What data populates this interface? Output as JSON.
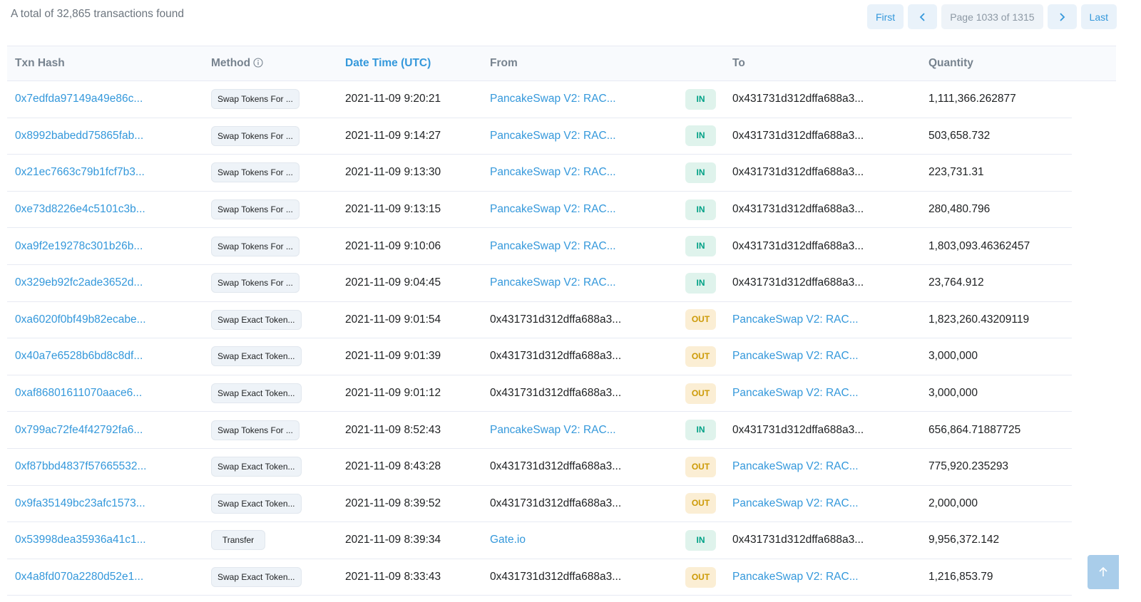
{
  "summary": "A total of 32,865 transactions found",
  "pager": {
    "first": "First",
    "page_info": "Page 1033 of 1315",
    "last": "Last"
  },
  "headers": {
    "txn_hash": "Txn Hash",
    "method": "Method",
    "datetime": "Date Time (UTC)",
    "from": "From",
    "to": "To",
    "quantity": "Quantity"
  },
  "rows": [
    {
      "hash": "0x7edfda97149a49e86c...",
      "method": "Swap Tokens For ...",
      "datetime": "2021-11-09 9:20:21",
      "from": "PancakeSwap V2: RAC...",
      "dir": "IN",
      "to": "0x431731d312dffa688a3...",
      "quantity": "1,111,366.262877"
    },
    {
      "hash": "0x8992babedd75865fab...",
      "method": "Swap Tokens For ...",
      "datetime": "2021-11-09 9:14:27",
      "from": "PancakeSwap V2: RAC...",
      "dir": "IN",
      "to": "0x431731d312dffa688a3...",
      "quantity": "503,658.732"
    },
    {
      "hash": "0x21ec7663c79b1fcf7b3...",
      "method": "Swap Tokens For ...",
      "datetime": "2021-11-09 9:13:30",
      "from": "PancakeSwap V2: RAC...",
      "dir": "IN",
      "to": "0x431731d312dffa688a3...",
      "quantity": "223,731.31"
    },
    {
      "hash": "0xe73d8226e4c5101c3b...",
      "method": "Swap Tokens For ...",
      "datetime": "2021-11-09 9:13:15",
      "from": "PancakeSwap V2: RAC...",
      "dir": "IN",
      "to": "0x431731d312dffa688a3...",
      "quantity": "280,480.796"
    },
    {
      "hash": "0xa9f2e19278c301b26b...",
      "method": "Swap Tokens For ...",
      "datetime": "2021-11-09 9:10:06",
      "from": "PancakeSwap V2: RAC...",
      "dir": "IN",
      "to": "0x431731d312dffa688a3...",
      "quantity": "1,803,093.46362457"
    },
    {
      "hash": "0x329eb92fc2ade3652d...",
      "method": "Swap Tokens For ...",
      "datetime": "2021-11-09 9:04:45",
      "from": "PancakeSwap V2: RAC...",
      "dir": "IN",
      "to": "0x431731d312dffa688a3...",
      "quantity": "23,764.912"
    },
    {
      "hash": "0xa6020f0bf49b82ecabe...",
      "method": "Swap Exact Token...",
      "datetime": "2021-11-09 9:01:54",
      "from": "0x431731d312dffa688a3...",
      "dir": "OUT",
      "to": "PancakeSwap V2: RAC...",
      "quantity": "1,823,260.43209119"
    },
    {
      "hash": "0x40a7e6528b6bd8c8df...",
      "method": "Swap Exact Token...",
      "datetime": "2021-11-09 9:01:39",
      "from": "0x431731d312dffa688a3...",
      "dir": "OUT",
      "to": "PancakeSwap V2: RAC...",
      "quantity": "3,000,000"
    },
    {
      "hash": "0xaf86801611070aace6...",
      "method": "Swap Exact Token...",
      "datetime": "2021-11-09 9:01:12",
      "from": "0x431731d312dffa688a3...",
      "dir": "OUT",
      "to": "PancakeSwap V2: RAC...",
      "quantity": "3,000,000"
    },
    {
      "hash": "0x799ac72fe4f42792fa6...",
      "method": "Swap Tokens For ...",
      "datetime": "2021-11-09 8:52:43",
      "from": "PancakeSwap V2: RAC...",
      "dir": "IN",
      "to": "0x431731d312dffa688a3...",
      "quantity": "656,864.71887725"
    },
    {
      "hash": "0xf87bbd4837f57665532...",
      "method": "Swap Exact Token...",
      "datetime": "2021-11-09 8:43:28",
      "from": "0x431731d312dffa688a3...",
      "dir": "OUT",
      "to": "PancakeSwap V2: RAC...",
      "quantity": "775,920.235293"
    },
    {
      "hash": "0x9fa35149bc23afc1573...",
      "method": "Swap Exact Token...",
      "datetime": "2021-11-09 8:39:52",
      "from": "0x431731d312dffa688a3...",
      "dir": "OUT",
      "to": "PancakeSwap V2: RAC...",
      "quantity": "2,000,000"
    },
    {
      "hash": "0x53998dea35936a41c1...",
      "method": "Transfer",
      "datetime": "2021-11-09 8:39:34",
      "from": "Gate.io",
      "dir": "IN",
      "to": "0x431731d312dffa688a3...",
      "quantity": "9,956,372.142"
    },
    {
      "hash": "0x4a8fd070a2280d52e1...",
      "method": "Swap Exact Token...",
      "datetime": "2021-11-09 8:33:43",
      "from": "0x431731d312dffa688a3...",
      "dir": "OUT",
      "to": "PancakeSwap V2: RAC...",
      "quantity": "1,216,853.79"
    }
  ],
  "colors": {
    "link": "#3498db",
    "in_badge": "#00a186",
    "out_badge": "#cc9a06"
  },
  "icons": {
    "info": "info-circle-icon",
    "prev": "chevron-left-icon",
    "next": "chevron-right-icon",
    "scroll_top": "arrow-up-icon"
  }
}
